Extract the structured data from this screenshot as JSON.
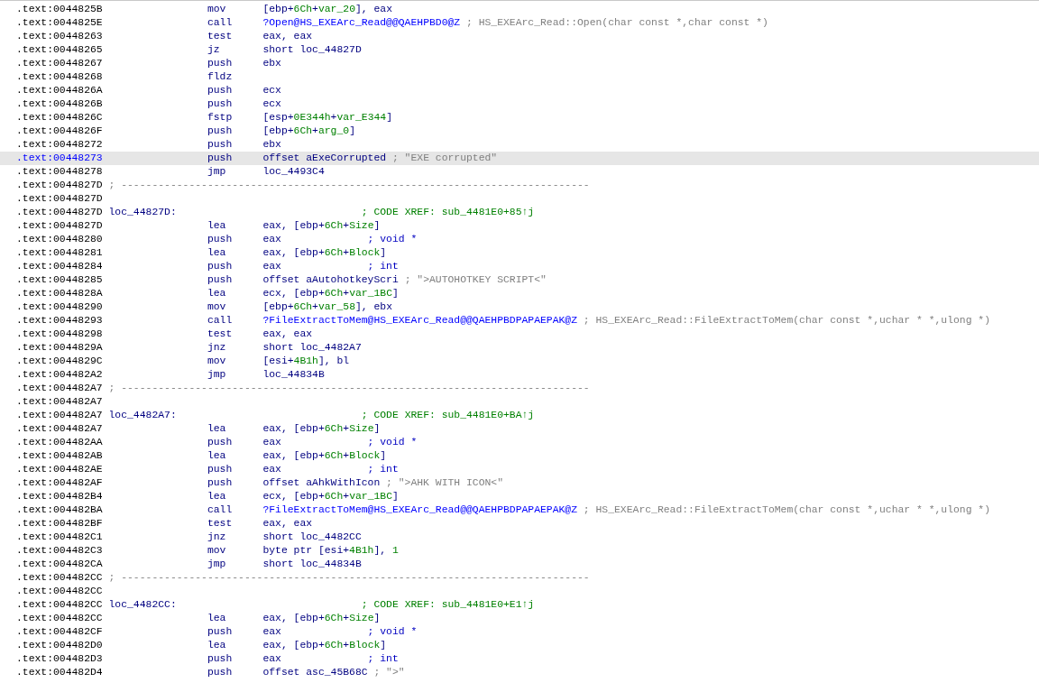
{
  "lines": [
    {
      "address": ".text:0044825B",
      "kind": "code",
      "selected": false,
      "mnemonic": "mov",
      "operands": [
        {
          "text": "[ebp+",
          "kind": "reg"
        },
        {
          "text": "6Ch",
          "kind": "num"
        },
        {
          "text": "+",
          "kind": "reg"
        },
        {
          "text": "var_20",
          "kind": "num"
        },
        {
          "text": "], eax",
          "kind": "reg"
        }
      ]
    },
    {
      "address": ".text:0044825E",
      "kind": "code",
      "selected": false,
      "mnemonic": "call",
      "operands": [
        {
          "text": "?Open@HS_EXEArc_Read@@QAEHPBD0@Z",
          "kind": "name"
        }
      ],
      "comment": {
        "text": "; HS_EXEArc_Read::Open(char const *,char const *)",
        "kind": "note"
      }
    },
    {
      "address": ".text:00448263",
      "kind": "code",
      "selected": false,
      "mnemonic": "test",
      "operands": [
        {
          "text": "eax, eax",
          "kind": "reg"
        }
      ]
    },
    {
      "address": ".text:00448265",
      "kind": "code",
      "selected": false,
      "mnemonic": "jz",
      "operands": [
        {
          "text": "short loc_44827D",
          "kind": "reg"
        }
      ]
    },
    {
      "address": ".text:00448267",
      "kind": "code",
      "selected": false,
      "mnemonic": "push",
      "operands": [
        {
          "text": "ebx",
          "kind": "reg"
        }
      ]
    },
    {
      "address": ".text:00448268",
      "kind": "code",
      "selected": false,
      "mnemonic": "fldz"
    },
    {
      "address": ".text:0044826A",
      "kind": "code",
      "selected": false,
      "mnemonic": "push",
      "operands": [
        {
          "text": "ecx",
          "kind": "reg"
        }
      ]
    },
    {
      "address": ".text:0044826B",
      "kind": "code",
      "selected": false,
      "mnemonic": "push",
      "operands": [
        {
          "text": "ecx",
          "kind": "reg"
        }
      ]
    },
    {
      "address": ".text:0044826C",
      "kind": "code",
      "selected": false,
      "mnemonic": "fstp",
      "operands": [
        {
          "text": "[esp+",
          "kind": "reg"
        },
        {
          "text": "0E344h",
          "kind": "num"
        },
        {
          "text": "+",
          "kind": "reg"
        },
        {
          "text": "var_E344",
          "kind": "num"
        },
        {
          "text": "]",
          "kind": "reg"
        }
      ]
    },
    {
      "address": ".text:0044826F",
      "kind": "code",
      "selected": false,
      "mnemonic": "push",
      "operands": [
        {
          "text": "[ebp+",
          "kind": "reg"
        },
        {
          "text": "6Ch",
          "kind": "num"
        },
        {
          "text": "+",
          "kind": "reg"
        },
        {
          "text": "arg_0",
          "kind": "num"
        },
        {
          "text": "]",
          "kind": "reg"
        }
      ]
    },
    {
      "address": ".text:00448272",
      "kind": "code",
      "selected": false,
      "mnemonic": "push",
      "operands": [
        {
          "text": "ebx",
          "kind": "reg"
        }
      ]
    },
    {
      "address": ".text:00448273",
      "kind": "code",
      "selected": true,
      "mnemonic": "push",
      "operands": [
        {
          "text": "offset aExeCorrupted",
          "kind": "reg"
        }
      ],
      "comment": {
        "text": "; \"EXE corrupted\"",
        "kind": "note"
      }
    },
    {
      "address": ".text:00448278",
      "kind": "code",
      "selected": false,
      "mnemonic": "jmp",
      "operands": [
        {
          "text": "loc_4493C4",
          "kind": "reg"
        }
      ]
    },
    {
      "address": ".text:0044827D",
      "kind": "separator",
      "selected": false,
      "comment": {
        "text": "; ----------------------------------------------------------------------------",
        "kind": "note"
      }
    },
    {
      "address": ".text:0044827D",
      "kind": "blank",
      "selected": false
    },
    {
      "address": ".text:0044827D",
      "kind": "label",
      "selected": false,
      "label": "loc_44827D:",
      "comment": {
        "text": "; CODE XREF: sub_4481E0+85↑j",
        "kind": "xref"
      }
    },
    {
      "address": ".text:0044827D",
      "kind": "code",
      "selected": false,
      "mnemonic": "lea",
      "operands": [
        {
          "text": "eax, [ebp+",
          "kind": "reg"
        },
        {
          "text": "6Ch",
          "kind": "num"
        },
        {
          "text": "+",
          "kind": "reg"
        },
        {
          "text": "Size",
          "kind": "num"
        },
        {
          "text": "]",
          "kind": "reg"
        }
      ]
    },
    {
      "address": ".text:00448280",
      "kind": "code",
      "selected": false,
      "mnemonic": "push",
      "operands": [
        {
          "text": "eax",
          "kind": "reg"
        }
      ],
      "comment": {
        "text": "; void *",
        "kind": "type"
      }
    },
    {
      "address": ".text:00448281",
      "kind": "code",
      "selected": false,
      "mnemonic": "lea",
      "operands": [
        {
          "text": "eax, [ebp+",
          "kind": "reg"
        },
        {
          "text": "6Ch",
          "kind": "num"
        },
        {
          "text": "+",
          "kind": "reg"
        },
        {
          "text": "Block",
          "kind": "num"
        },
        {
          "text": "]",
          "kind": "reg"
        }
      ]
    },
    {
      "address": ".text:00448284",
      "kind": "code",
      "selected": false,
      "mnemonic": "push",
      "operands": [
        {
          "text": "eax",
          "kind": "reg"
        }
      ],
      "comment": {
        "text": "; int",
        "kind": "type"
      }
    },
    {
      "address": ".text:00448285",
      "kind": "code",
      "selected": false,
      "mnemonic": "push",
      "operands": [
        {
          "text": "offset aAutohotkeyScri",
          "kind": "reg"
        }
      ],
      "comment": {
        "text": "; \">AUTOHOTKEY SCRIPT<\"",
        "kind": "note"
      }
    },
    {
      "address": ".text:0044828A",
      "kind": "code",
      "selected": false,
      "mnemonic": "lea",
      "operands": [
        {
          "text": "ecx, [ebp+",
          "kind": "reg"
        },
        {
          "text": "6Ch",
          "kind": "num"
        },
        {
          "text": "+",
          "kind": "reg"
        },
        {
          "text": "var_1BC",
          "kind": "num"
        },
        {
          "text": "]",
          "kind": "reg"
        }
      ]
    },
    {
      "address": ".text:00448290",
      "kind": "code",
      "selected": false,
      "mnemonic": "mov",
      "operands": [
        {
          "text": "[ebp+",
          "kind": "reg"
        },
        {
          "text": "6Ch",
          "kind": "num"
        },
        {
          "text": "+",
          "kind": "reg"
        },
        {
          "text": "var_58",
          "kind": "num"
        },
        {
          "text": "], ebx",
          "kind": "reg"
        }
      ]
    },
    {
      "address": ".text:00448293",
      "kind": "code",
      "selected": false,
      "mnemonic": "call",
      "operands": [
        {
          "text": "?FileExtractToMem@HS_EXEArc_Read@@QAEHPBDPAPAEPAK@Z",
          "kind": "name"
        }
      ],
      "comment": {
        "text": "; HS_EXEArc_Read::FileExtractToMem(char const *,uchar * *,ulong *)",
        "kind": "note"
      }
    },
    {
      "address": ".text:00448298",
      "kind": "code",
      "selected": false,
      "mnemonic": "test",
      "operands": [
        {
          "text": "eax, eax",
          "kind": "reg"
        }
      ]
    },
    {
      "address": ".text:0044829A",
      "kind": "code",
      "selected": false,
      "mnemonic": "jnz",
      "operands": [
        {
          "text": "short loc_4482A7",
          "kind": "reg"
        }
      ]
    },
    {
      "address": ".text:0044829C",
      "kind": "code",
      "selected": false,
      "mnemonic": "mov",
      "operands": [
        {
          "text": "[esi+",
          "kind": "reg"
        },
        {
          "text": "4B1h",
          "kind": "num"
        },
        {
          "text": "], bl",
          "kind": "reg"
        }
      ]
    },
    {
      "address": ".text:004482A2",
      "kind": "code",
      "selected": false,
      "mnemonic": "jmp",
      "operands": [
        {
          "text": "loc_44834B",
          "kind": "reg"
        }
      ]
    },
    {
      "address": ".text:004482A7",
      "kind": "separator",
      "selected": false,
      "comment": {
        "text": "; ----------------------------------------------------------------------------",
        "kind": "note"
      }
    },
    {
      "address": ".text:004482A7",
      "kind": "blank",
      "selected": false
    },
    {
      "address": ".text:004482A7",
      "kind": "label",
      "selected": false,
      "label": "loc_4482A7:",
      "comment": {
        "text": "; CODE XREF: sub_4481E0+BA↑j",
        "kind": "xref"
      }
    },
    {
      "address": ".text:004482A7",
      "kind": "code",
      "selected": false,
      "mnemonic": "lea",
      "operands": [
        {
          "text": "eax, [ebp+",
          "kind": "reg"
        },
        {
          "text": "6Ch",
          "kind": "num"
        },
        {
          "text": "+",
          "kind": "reg"
        },
        {
          "text": "Size",
          "kind": "num"
        },
        {
          "text": "]",
          "kind": "reg"
        }
      ]
    },
    {
      "address": ".text:004482AA",
      "kind": "code",
      "selected": false,
      "mnemonic": "push",
      "operands": [
        {
          "text": "eax",
          "kind": "reg"
        }
      ],
      "comment": {
        "text": "; void *",
        "kind": "type"
      }
    },
    {
      "address": ".text:004482AB",
      "kind": "code",
      "selected": false,
      "mnemonic": "lea",
      "operands": [
        {
          "text": "eax, [ebp+",
          "kind": "reg"
        },
        {
          "text": "6Ch",
          "kind": "num"
        },
        {
          "text": "+",
          "kind": "reg"
        },
        {
          "text": "Block",
          "kind": "num"
        },
        {
          "text": "]",
          "kind": "reg"
        }
      ]
    },
    {
      "address": ".text:004482AE",
      "kind": "code",
      "selected": false,
      "mnemonic": "push",
      "operands": [
        {
          "text": "eax",
          "kind": "reg"
        }
      ],
      "comment": {
        "text": "; int",
        "kind": "type"
      }
    },
    {
      "address": ".text:004482AF",
      "kind": "code",
      "selected": false,
      "mnemonic": "push",
      "operands": [
        {
          "text": "offset aAhkWithIcon",
          "kind": "reg"
        }
      ],
      "comment": {
        "text": "; \">AHK WITH ICON<\"",
        "kind": "note"
      }
    },
    {
      "address": ".text:004482B4",
      "kind": "code",
      "selected": false,
      "mnemonic": "lea",
      "operands": [
        {
          "text": "ecx, [ebp+",
          "kind": "reg"
        },
        {
          "text": "6Ch",
          "kind": "num"
        },
        {
          "text": "+",
          "kind": "reg"
        },
        {
          "text": "var_1BC",
          "kind": "num"
        },
        {
          "text": "]",
          "kind": "reg"
        }
      ]
    },
    {
      "address": ".text:004482BA",
      "kind": "code",
      "selected": false,
      "mnemonic": "call",
      "operands": [
        {
          "text": "?FileExtractToMem@HS_EXEArc_Read@@QAEHPBDPAPAEPAK@Z",
          "kind": "name"
        }
      ],
      "comment": {
        "text": "; HS_EXEArc_Read::FileExtractToMem(char const *,uchar * *,ulong *)",
        "kind": "note"
      }
    },
    {
      "address": ".text:004482BF",
      "kind": "code",
      "selected": false,
      "mnemonic": "test",
      "operands": [
        {
          "text": "eax, eax",
          "kind": "reg"
        }
      ]
    },
    {
      "address": ".text:004482C1",
      "kind": "code",
      "selected": false,
      "mnemonic": "jnz",
      "operands": [
        {
          "text": "short loc_4482CC",
          "kind": "reg"
        }
      ]
    },
    {
      "address": ".text:004482C3",
      "kind": "code",
      "selected": false,
      "mnemonic": "mov",
      "operands": [
        {
          "text": "byte ptr [esi+",
          "kind": "reg"
        },
        {
          "text": "4B1h",
          "kind": "num"
        },
        {
          "text": "], ",
          "kind": "reg"
        },
        {
          "text": "1",
          "kind": "num"
        }
      ]
    },
    {
      "address": ".text:004482CA",
      "kind": "code",
      "selected": false,
      "mnemonic": "jmp",
      "operands": [
        {
          "text": "short loc_44834B",
          "kind": "reg"
        }
      ]
    },
    {
      "address": ".text:004482CC",
      "kind": "separator",
      "selected": false,
      "comment": {
        "text": "; ----------------------------------------------------------------------------",
        "kind": "note"
      }
    },
    {
      "address": ".text:004482CC",
      "kind": "blank",
      "selected": false
    },
    {
      "address": ".text:004482CC",
      "kind": "label",
      "selected": false,
      "label": "loc_4482CC:",
      "comment": {
        "text": "; CODE XREF: sub_4481E0+E1↑j",
        "kind": "xref"
      }
    },
    {
      "address": ".text:004482CC",
      "kind": "code",
      "selected": false,
      "mnemonic": "lea",
      "operands": [
        {
          "text": "eax, [ebp+",
          "kind": "reg"
        },
        {
          "text": "6Ch",
          "kind": "num"
        },
        {
          "text": "+",
          "kind": "reg"
        },
        {
          "text": "Size",
          "kind": "num"
        },
        {
          "text": "]",
          "kind": "reg"
        }
      ]
    },
    {
      "address": ".text:004482CF",
      "kind": "code",
      "selected": false,
      "mnemonic": "push",
      "operands": [
        {
          "text": "eax",
          "kind": "reg"
        }
      ],
      "comment": {
        "text": "; void *",
        "kind": "type"
      }
    },
    {
      "address": ".text:004482D0",
      "kind": "code",
      "selected": false,
      "mnemonic": "lea",
      "operands": [
        {
          "text": "eax, [ebp+",
          "kind": "reg"
        },
        {
          "text": "6Ch",
          "kind": "num"
        },
        {
          "text": "+",
          "kind": "reg"
        },
        {
          "text": "Block",
          "kind": "num"
        },
        {
          "text": "]",
          "kind": "reg"
        }
      ]
    },
    {
      "address": ".text:004482D3",
      "kind": "code",
      "selected": false,
      "mnemonic": "push",
      "operands": [
        {
          "text": "eax",
          "kind": "reg"
        }
      ],
      "comment": {
        "text": "; int",
        "kind": "type"
      }
    },
    {
      "address": ".text:004482D4",
      "kind": "code",
      "selected": false,
      "mnemonic": "push",
      "operands": [
        {
          "text": "offset asc_45B68C",
          "kind": "reg"
        }
      ],
      "comment": {
        "text": "; \">\"",
        "kind": "note"
      }
    }
  ]
}
